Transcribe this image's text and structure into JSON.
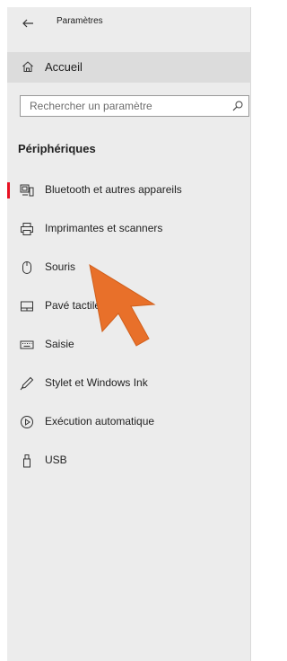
{
  "window": {
    "title": "Paramètres",
    "back_icon": "back-arrow-icon"
  },
  "home": {
    "label": "Accueil",
    "icon": "home-icon"
  },
  "search": {
    "placeholder": "Rechercher un paramètre",
    "value": "",
    "icon": "search-icon"
  },
  "section": {
    "title": "Périphériques"
  },
  "nav": {
    "items": [
      {
        "label": "Bluetooth et autres appareils",
        "icon": "bluetooth-devices-icon",
        "selected": true
      },
      {
        "label": "Imprimantes et scanners",
        "icon": "printer-icon",
        "selected": false
      },
      {
        "label": "Souris",
        "icon": "mouse-icon",
        "selected": false
      },
      {
        "label": "Pavé tactile",
        "icon": "touchpad-icon",
        "selected": false
      },
      {
        "label": "Saisie",
        "icon": "keyboard-icon",
        "selected": false
      },
      {
        "label": "Stylet et Windows Ink",
        "icon": "pen-icon",
        "selected": false
      },
      {
        "label": "Exécution automatique",
        "icon": "autoplay-icon",
        "selected": false
      },
      {
        "label": "USB",
        "icon": "usb-icon",
        "selected": false
      }
    ]
  },
  "colors": {
    "accent": "#e81123",
    "panel": "#ececec",
    "highlight": "#dcdcdc",
    "pointer": "#e8702a"
  },
  "overlay": {
    "icon": "pointer-arrow-icon"
  }
}
